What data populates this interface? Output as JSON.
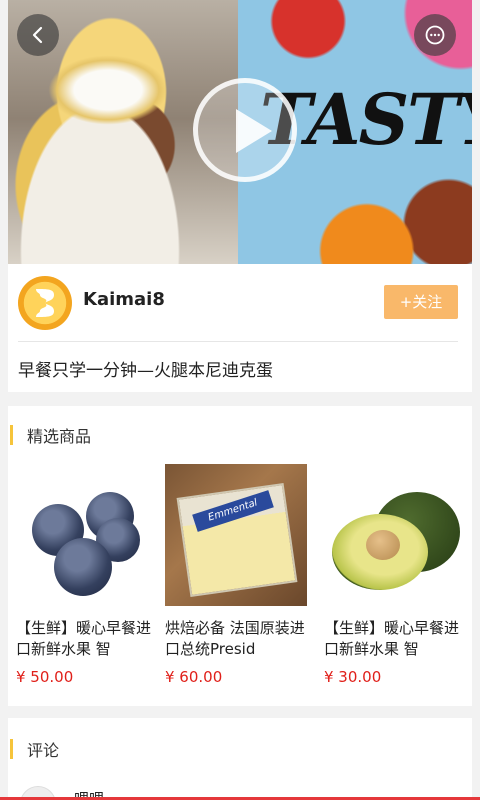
{
  "video": {
    "overlay_text": "TASTY",
    "back_icon": "chevron-left-icon",
    "chat_icon": "chat-bubble-icon",
    "play_icon": "play-icon"
  },
  "author": {
    "name": "Kaimai8",
    "follow_label": "+关注",
    "avatar_icon": "brand-logo-icon",
    "accent": "#f9b86a"
  },
  "video_title": "早餐只学一分钟—火腿本尼迪克蛋",
  "products_section": {
    "title": "精选商品",
    "accent": "#f6c43b",
    "items": [
      {
        "name": "【生鲜】暖心早餐进口新鲜水果 智",
        "price": "¥ 50.00",
        "image": "blueberries"
      },
      {
        "name": "烘焙必备 法国原装进口总统Presid",
        "price": "¥ 60.00",
        "image": "emmental-cheese",
        "image_text": "Emmental"
      },
      {
        "name": "【生鲜】暖心早餐进口新鲜水果 智",
        "price": "¥ 30.00",
        "image": "avocado"
      }
    ]
  },
  "comments_section": {
    "title": "评论",
    "first_user": "哩哩"
  },
  "colors": {
    "price": "#e0201a",
    "bottom_bar": "#e5383b"
  }
}
